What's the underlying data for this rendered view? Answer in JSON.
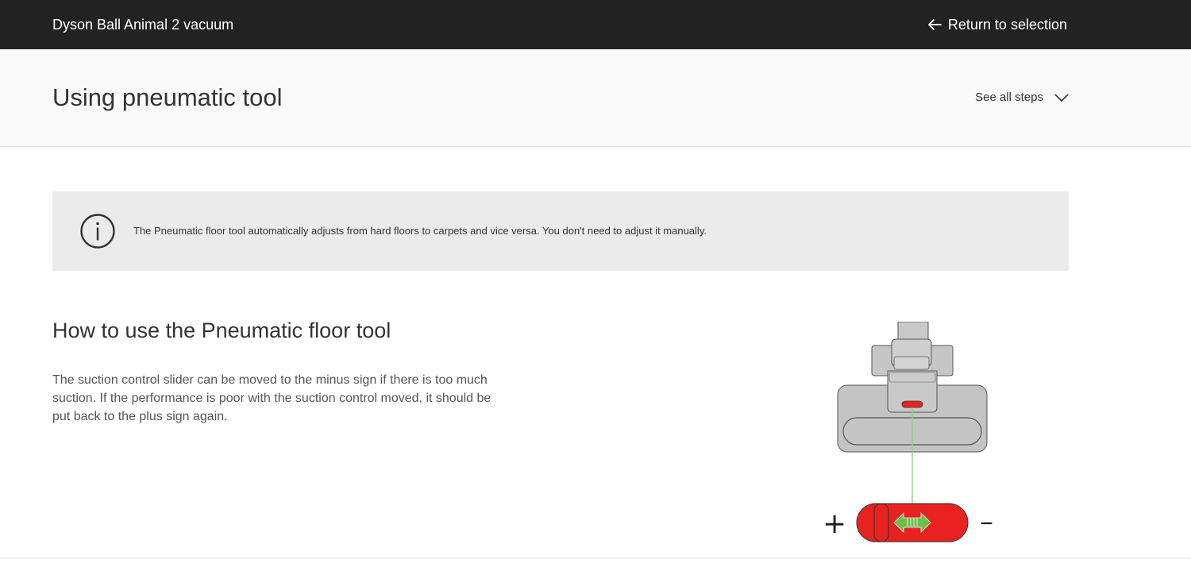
{
  "header": {
    "product_name": "Dyson Ball Animal 2 vacuum",
    "return_label": "Return to selection"
  },
  "step": {
    "title": "Using pneumatic tool",
    "see_all_label": "See all steps"
  },
  "notice": {
    "icon": "info-icon",
    "text": "The Pneumatic floor tool automatically adjusts from hard floors to carpets and vice versa. You don't need to adjust it manually."
  },
  "howto": {
    "title": "How to use the Pneumatic floor tool",
    "body": "The suction control slider can be moved to the minus sign if there is too much suction. If the performance is poor with the suction control moved, it should be put back to the plus sign again."
  },
  "illustration": {
    "plus_sign": "+",
    "minus_sign": "–",
    "slider_color": "#e8221f",
    "arrow_color": "#6cbf4a"
  },
  "colors": {
    "topbar_bg": "#222222",
    "stepbar_bg": "#f9f9f9",
    "notice_bg": "#ebebeb"
  }
}
